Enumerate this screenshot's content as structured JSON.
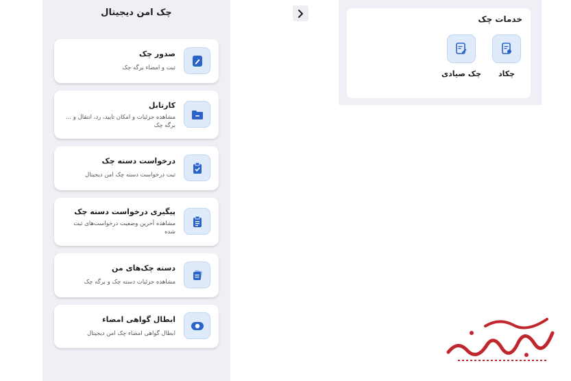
{
  "digital_check": {
    "title": "چک امن دیجیتال",
    "items": [
      {
        "title": "صدور چک",
        "desc": "ثبت و امضاء برگه چک",
        "icon": "check-issue-icon"
      },
      {
        "title": "کارتابل",
        "desc": "مشاهده جزئیات و امکان تایید، رد، انتقال و ... برگه چک",
        "icon": "folder-icon"
      },
      {
        "title": "درخواست دسته چک",
        "desc": "ثبت درخواست دسته چک امن دیجیتال",
        "icon": "clipboard-check-icon"
      },
      {
        "title": "پیگیری درخواست دسته چک",
        "desc": "مشاهده آخرین وضعیت درخواست‌های ثبت شده",
        "icon": "clipboard-list-icon"
      },
      {
        "title": "دسته چک‌های من",
        "desc": "مشاهده جزئیات دسته چک و برگه چک",
        "icon": "checkbook-icon"
      },
      {
        "title": "ابطال گواهی امضاء",
        "desc": "ابطال گواهی امضاء چک امن دیجیتال",
        "icon": "toggle-icon"
      }
    ]
  },
  "services": {
    "title": "خدمات چک",
    "items": [
      {
        "label": "چکاد",
        "icon": "chakad-icon"
      },
      {
        "label": "چک صیادی",
        "icon": "sayadi-check-icon"
      }
    ]
  },
  "watermark": {
    "text": "صفحه اقتصاد"
  },
  "colors": {
    "panel_bg": "#eef0f5",
    "icon_bg": "#dfeafa",
    "icon_fg": "#2a62c9",
    "watermark": "#c0272d"
  }
}
